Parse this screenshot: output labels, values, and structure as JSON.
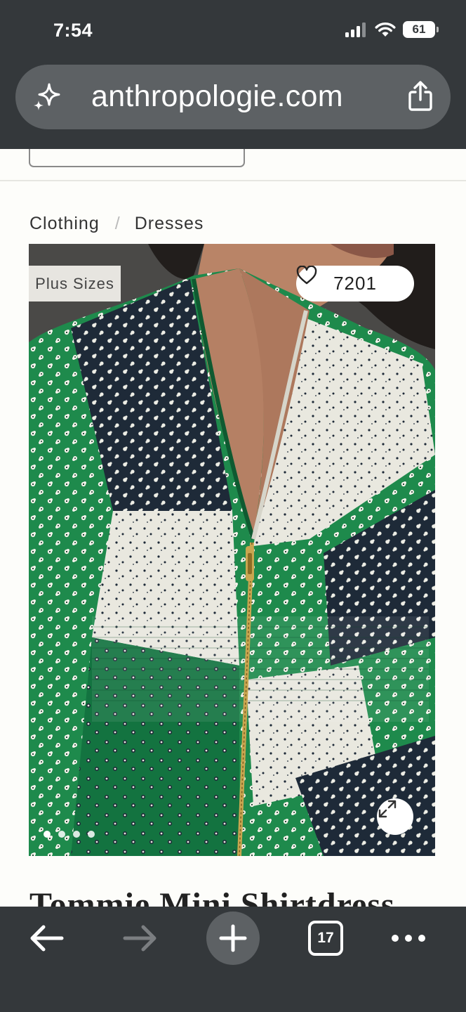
{
  "status_bar": {
    "time": "7:54",
    "battery": "61"
  },
  "browser": {
    "url": "anthropologie.com"
  },
  "breadcrumb": {
    "items": [
      "Clothing",
      "Dresses"
    ],
    "separator": "/"
  },
  "product": {
    "badge": "Plus Sizes",
    "wishlist_count": "7201",
    "title": "Tommie Mini Shirtdress",
    "image_count": 4,
    "active_image": 1
  },
  "toolbar": {
    "tab_count": "17"
  },
  "colors": {
    "chrome": "#34383b",
    "url_bar": "#5d6164",
    "page_bg": "#fdfdfa",
    "dress_green": "#1e8a4c"
  }
}
